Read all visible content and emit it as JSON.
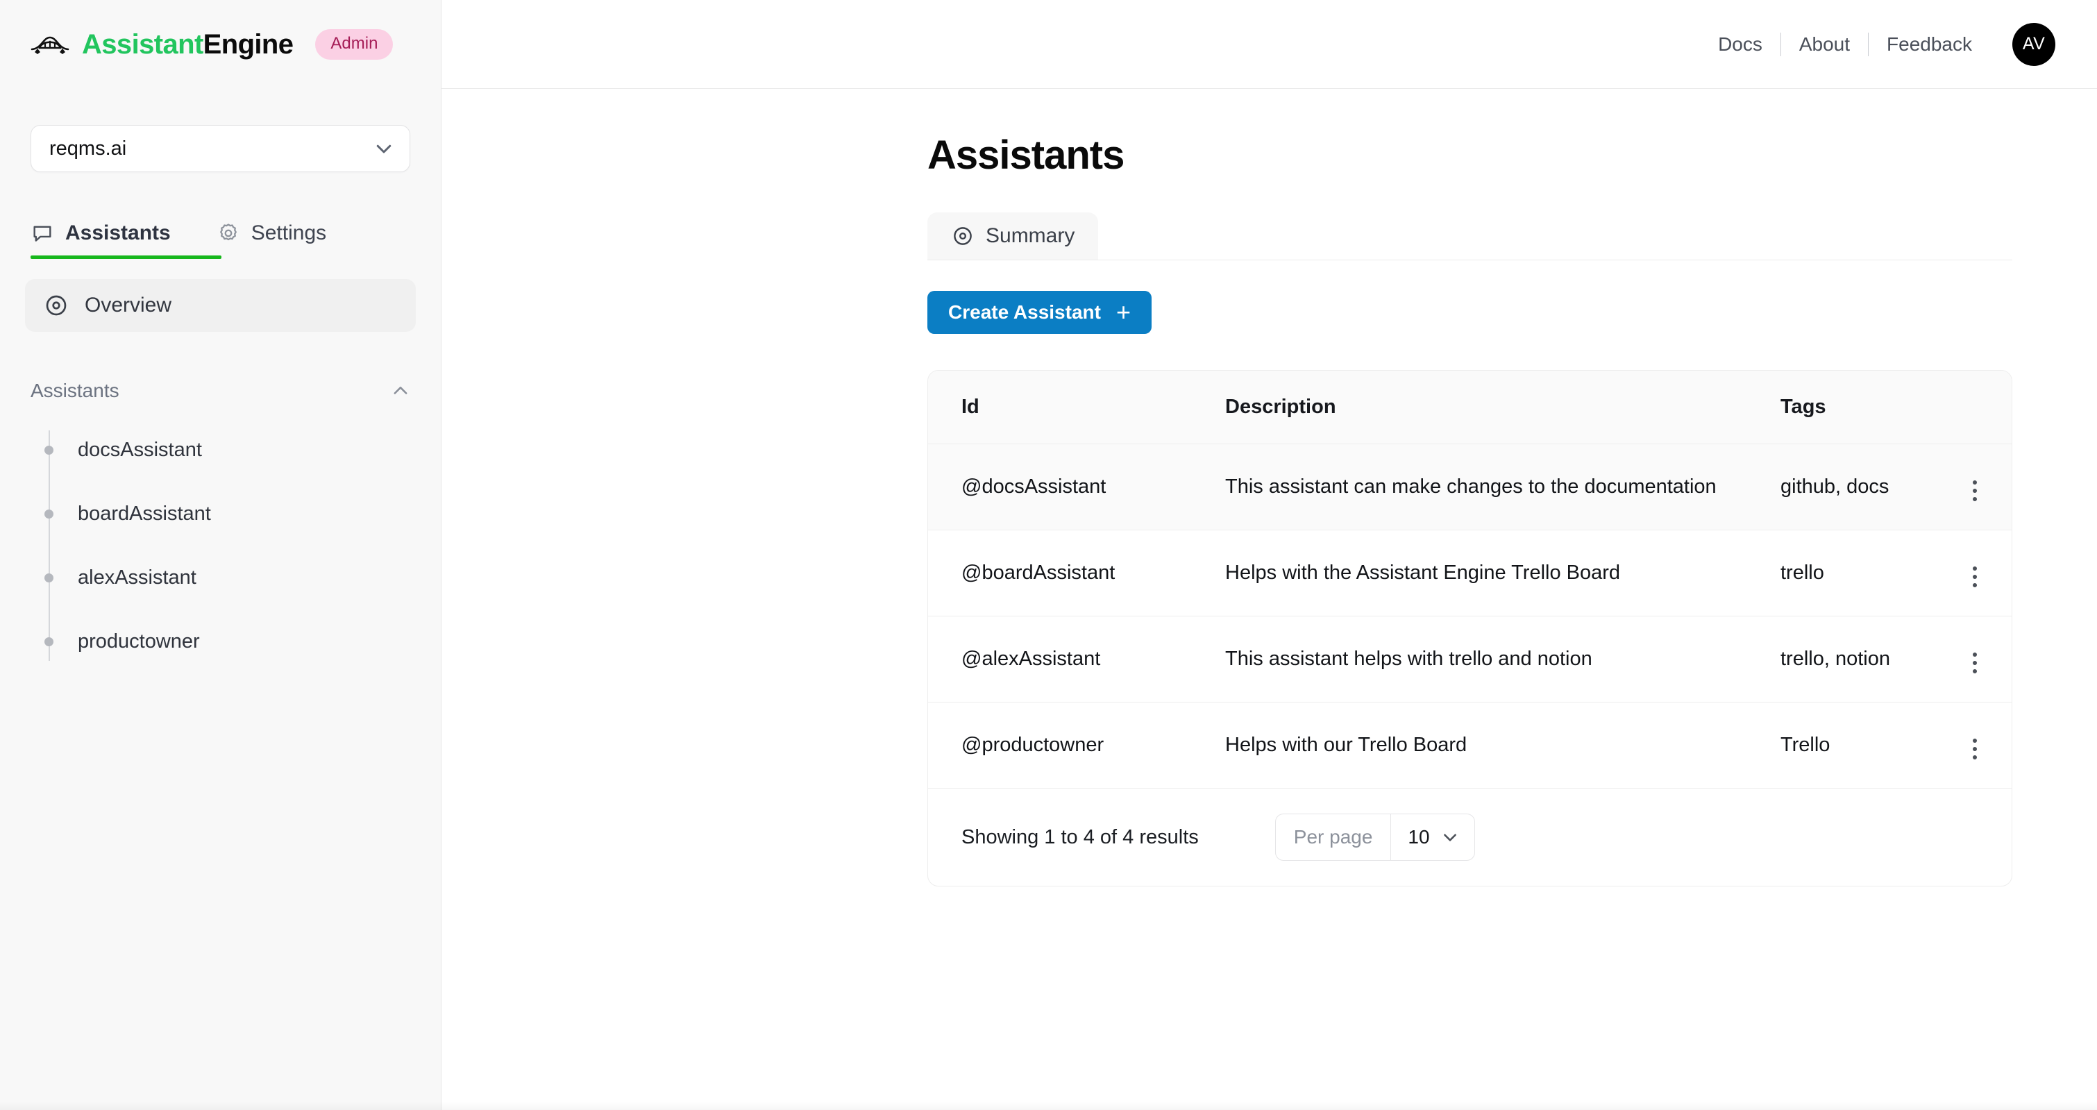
{
  "brand": {
    "logo_icon": "bridge-icon",
    "name_accent": "Assistant",
    "name_rest": "Engine",
    "badge": "Admin",
    "accent_color": "#22c55e",
    "badge_bg": "#fbd0e4",
    "badge_fg": "#a51c56"
  },
  "sidebar": {
    "workspace": {
      "value": "reqms.ai",
      "chevron_icon": "chevron-down-icon"
    },
    "tabs": [
      {
        "label": "Assistants",
        "icon": "chat-bubble-icon",
        "active": true
      },
      {
        "label": "Settings",
        "icon": "gear-icon",
        "active": false
      }
    ],
    "nav": {
      "overview_label": "Overview",
      "overview_icon": "circle-dot-icon"
    },
    "section": {
      "label": "Assistants",
      "collapse_icon": "chevron-up-icon"
    },
    "assistants": [
      {
        "name": "docsAssistant"
      },
      {
        "name": "boardAssistant"
      },
      {
        "name": "alexAssistant"
      },
      {
        "name": "productowner"
      }
    ]
  },
  "topbar": {
    "links": [
      "Docs",
      "About",
      "Feedback"
    ],
    "avatar_initials": "AV"
  },
  "main": {
    "title": "Assistants",
    "tabstrip": [
      {
        "label": "Summary",
        "icon": "circle-dot-icon"
      }
    ],
    "create_button": {
      "label": "Create Assistant",
      "plus_icon": "plus-icon",
      "color": "#0b7ec4"
    },
    "table": {
      "columns": [
        "Id",
        "Description",
        "Tags"
      ],
      "menu_icon": "kebab-menu-icon",
      "rows": [
        {
          "id": "@docsAssistant",
          "description": "This assistant can make changes to the documentation",
          "tags": "github, docs"
        },
        {
          "id": "@boardAssistant",
          "description": "Helps with the Assistant Engine Trello Board",
          "tags": "trello"
        },
        {
          "id": "@alexAssistant",
          "description": "This assistant helps with trello and notion",
          "tags": "trello, notion"
        },
        {
          "id": "@productowner",
          "description": "Helps with our Trello Board",
          "tags": "Trello"
        }
      ]
    },
    "footer": {
      "results_text": "Showing 1 to 4 of 4 results",
      "per_page_label": "Per page",
      "per_page_value": "10",
      "per_page_chevron": "chevron-down-icon"
    }
  }
}
